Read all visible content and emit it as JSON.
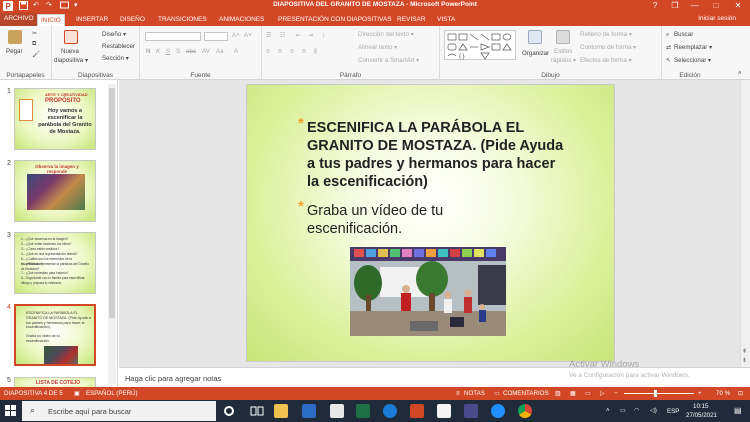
{
  "window": {
    "title": "DIAPOSITIVA DEL GRANITO DE MOSTAZA - Microsoft PowerPoint",
    "controls": {
      "help": "?",
      "restore": "❐",
      "minimize": "—",
      "maximize": "□",
      "close": "✕"
    }
  },
  "tabs": [
    {
      "label": "ARCHIVO"
    },
    {
      "label": "INICIO"
    },
    {
      "label": "INSERTAR"
    },
    {
      "label": "DISEÑO"
    },
    {
      "label": "TRANSICIONES"
    },
    {
      "label": "ANIMACIONES"
    },
    {
      "label": "PRESENTACIÓN CON DIAPOSITIVAS"
    },
    {
      "label": "REVISAR"
    },
    {
      "label": "VISTA"
    }
  ],
  "active_tab": "INICIO",
  "signin": "Iniciar sesión",
  "ribbon": {
    "portapapeles": {
      "label": "Portapapeles",
      "pegar": "Pegar"
    },
    "diapositivas": {
      "label": "Diapositivas",
      "nueva_1": "Nueva",
      "nueva_2": "diapositiva ▾",
      "diseno": "Diseño ▾",
      "restablecer": "Restablecer",
      "seccion": "Sección ▾"
    },
    "fuente": {
      "label": "Fuente"
    },
    "parrafo": {
      "label": "Párrafo",
      "direccion": "Dirección del texto ▾",
      "alinear": "Alinear texto ▾",
      "smartart": "Convertir a SmartArt ▾"
    },
    "dibujo": {
      "label": "Dibujo",
      "organizar": "Organizar",
      "estilos_1": "Estilos",
      "estilos_2": "rápidos ▾",
      "relleno": "Relleno de forma ▾",
      "contorno": "Contorno de forma ▾",
      "efectos": "Efectos de forma ▾"
    },
    "edicion": {
      "label": "Edición",
      "buscar": "Buscar",
      "reemplazar": "Reemplazar ▾",
      "seleccionar": "Seleccionar ▾"
    }
  },
  "thumbnails": [
    {
      "num": "1",
      "title_small": "ARTE Y CREATIVIDAD",
      "title": "PROPÓSITO",
      "text": "Hoy vamos a escenificar la parábola del Granito de Mostaza."
    },
    {
      "num": "2",
      "title": "Observa la imagen y responde"
    },
    {
      "num": "3",
      "lines": [
        "1.- ¿Qué observas en la imagen?",
        "2.- ¿Qué están haciendo los niños?",
        "3.- ¿Cómo están vestidos?",
        "4.- ¿Qué es una representación teatral?",
        "5.- ¿Cuáles son los elementos de la escenificación?",
        "6.- ¿Podrías representar la parábola del Granito de Mostaza?",
        "7.- ¿Qué necesitas para hacerlo?",
        "8.- Organízate con tu familia para escenificar, dibuja y prepara tu vestuario."
      ]
    },
    {
      "num": "4",
      "text1": "ESCENIFICA LA PARÁBOLA EL GRANITO DE MOSTAZA. (Pide Ayuda a tus padres y hermanos para hacer la escenificación)",
      "text2": "Graba un video de tu escenificación."
    },
    {
      "num": "5",
      "title": "LISTA DE COTEJO"
    }
  ],
  "slide": {
    "bullet_symbol": "*",
    "bullet1": "ESCENIFICA  LA PARÁBOLA EL GRANITO DE MOSTAZA. (Pide Ayuda a tus padres y hermanos para hacer la escenificación)",
    "bullet2": "Graba un vídeo de tu escenificación."
  },
  "notes_placeholder": "Haga clic para agregar notas",
  "status": {
    "slide_info": "DIAPOSITIVA 4 DE 5",
    "language": "ESPAÑOL (PERÚ)",
    "notes": "NOTAS",
    "comments": "COMENTARIOS",
    "zoom": "70 %",
    "zoom_fraction": 0.45
  },
  "watermark": {
    "line1": "Activar Windows",
    "line2": "Ve a Configuración para activar Windows."
  },
  "taskbar": {
    "search_placeholder": "Escribe aquí para buscar",
    "lang": "ESP",
    "time": "10:15",
    "date": "27/05/2021"
  },
  "colors": {
    "accent": "#d24726",
    "bullet": "#f0a030",
    "taskbar": "#1f2b3a"
  }
}
